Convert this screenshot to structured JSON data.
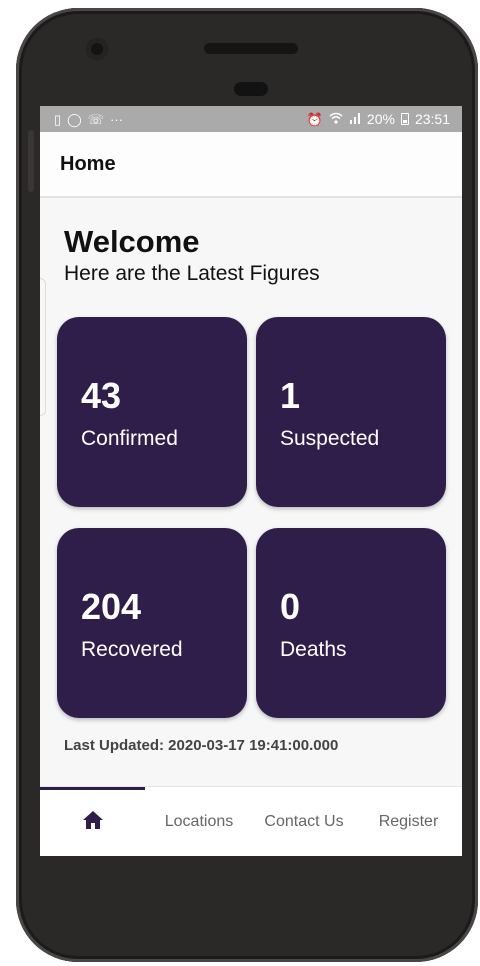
{
  "status_bar": {
    "left_icons": [
      "usb-icon",
      "sync-icon",
      "whatsapp-icon",
      "more-icon"
    ],
    "battery": "20%",
    "time": "23:51"
  },
  "app_bar": {
    "title": "Home"
  },
  "welcome": {
    "title": "Welcome",
    "subtitle": "Here are the Latest Figures"
  },
  "stats": [
    {
      "value": "43",
      "label": "Confirmed"
    },
    {
      "value": "1",
      "label": "Suspected"
    },
    {
      "value": "204",
      "label": "Recovered"
    },
    {
      "value": "0",
      "label": "Deaths"
    }
  ],
  "last_updated": "Last Updated: 2020-03-17 19:41:00.000",
  "bottom_nav": {
    "home_icon": "home-icon",
    "items": [
      "Locations",
      "Contact Us",
      "Register"
    ],
    "active": "home"
  },
  "colors": {
    "accent": "#2f1e4a",
    "status_bar": "#aaaaaa"
  }
}
